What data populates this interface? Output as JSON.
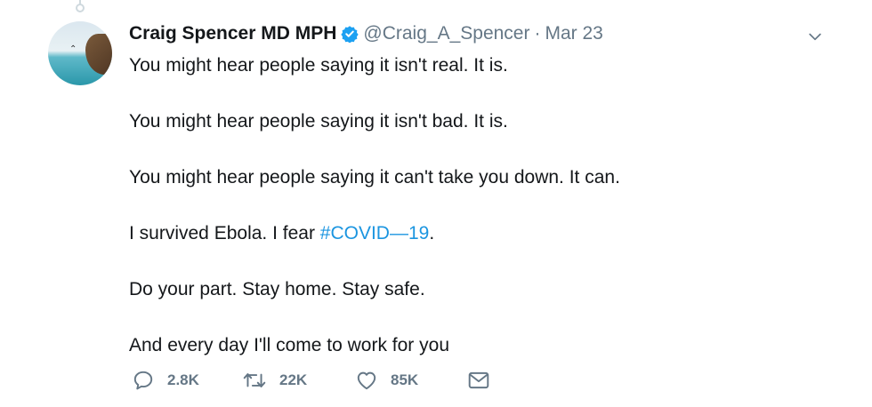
{
  "tweet": {
    "author": {
      "display_name": "Craig Spencer MD MPH",
      "verified": true,
      "handle": "@Craig_A_Spencer",
      "separator": "·",
      "date": "Mar 23"
    },
    "paragraphs": [
      {
        "text": "You might hear people saying it isn't real. It is."
      },
      {
        "text": "You might hear people saying it isn't bad. It is."
      },
      {
        "text": "You might hear people saying it can't take you down. It can."
      },
      {
        "text": "I survived Ebola. I fear ",
        "hashtag": "#COVID—19",
        "suffix": "."
      },
      {
        "text": "Do your part. Stay home. Stay safe."
      },
      {
        "text": "And every day I'll come to work for you"
      }
    ],
    "actions": {
      "reply_count": "2.8K",
      "retweet_count": "22K",
      "like_count": "85K"
    }
  },
  "icons": {
    "verified": "verified-badge-icon",
    "more": "chevron-down-icon",
    "reply": "reply-bubble-icon",
    "retweet": "retweet-arrows-icon",
    "like": "heart-icon",
    "message": "envelope-icon"
  },
  "colors": {
    "text": "#14171a",
    "muted": "#657786",
    "link": "#1b95e0",
    "verified": "#1da1f2"
  }
}
